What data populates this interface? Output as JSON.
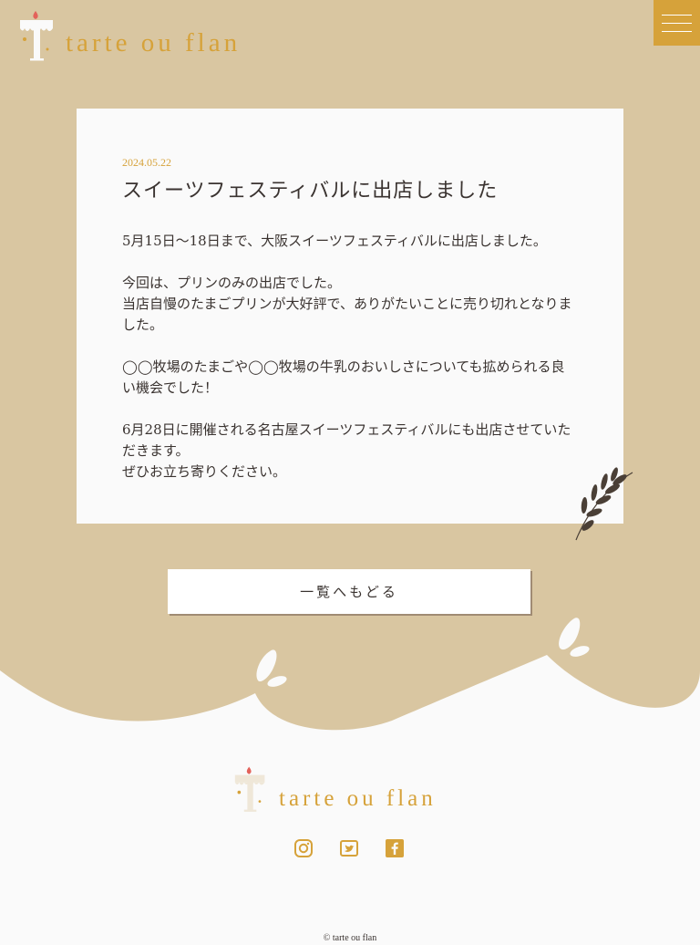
{
  "header": {
    "logo_text": "tarte ou flan",
    "menu_label": "menu"
  },
  "post": {
    "date": "2024.05.22",
    "title": "スイーツフェスティバルに出店しました",
    "paragraphs": [
      "5月15日〜18日まで、大阪スイーツフェスティバルに出店しました。",
      "今回は、プリンのみの出店でした。\n当店自慢のたまごプリンが大好評で、ありがたいことに売り切れとなりました。",
      "◯◯牧場のたまごや◯◯牧場の牛乳のおいしさについても拡められる良い機会でした！",
      "6月28日に開催される名古屋スイーツフェスティバルにも出店させていただきます。\nぜひお立ち寄りください。"
    ]
  },
  "back_button": {
    "label": "一覧へもどる"
  },
  "footer": {
    "logo_text": "tarte ou flan",
    "social": [
      "instagram-icon",
      "twitter-icon",
      "facebook-icon"
    ],
    "copyright": "© tarte ou flan"
  },
  "colors": {
    "beige": "#d9c6a1",
    "accent": "#d6a23a",
    "text": "#3a3330",
    "white": "#fafafa"
  }
}
